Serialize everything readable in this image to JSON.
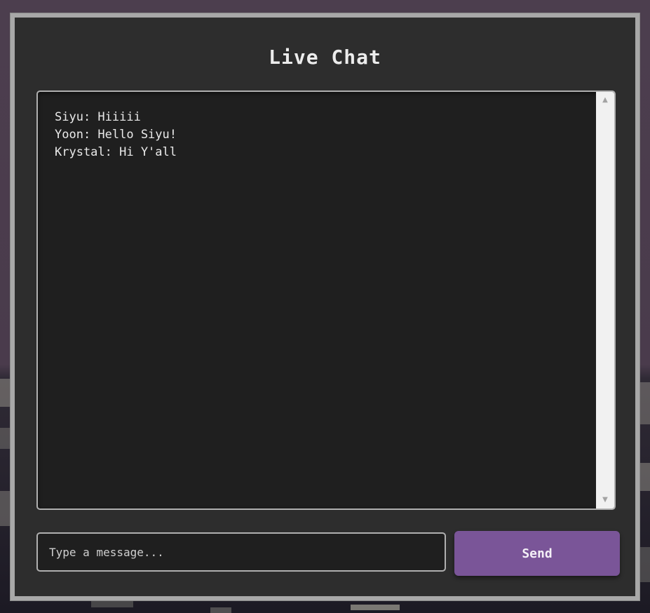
{
  "chat": {
    "title": "Live Chat",
    "messages": [
      {
        "text": "Siyu: Hiiiii"
      },
      {
        "text": "Yoon: Hello Siyu!"
      },
      {
        "text": "Krystal: Hi Y'all"
      }
    ]
  },
  "composer": {
    "placeholder": "Type a message...",
    "value": "",
    "send_label": "Send"
  },
  "colors": {
    "panel_background": "#2d2d2d",
    "chat_background": "#1f1f1f",
    "send_button": "#7a5598",
    "panel_border": "#a8a8a8"
  }
}
